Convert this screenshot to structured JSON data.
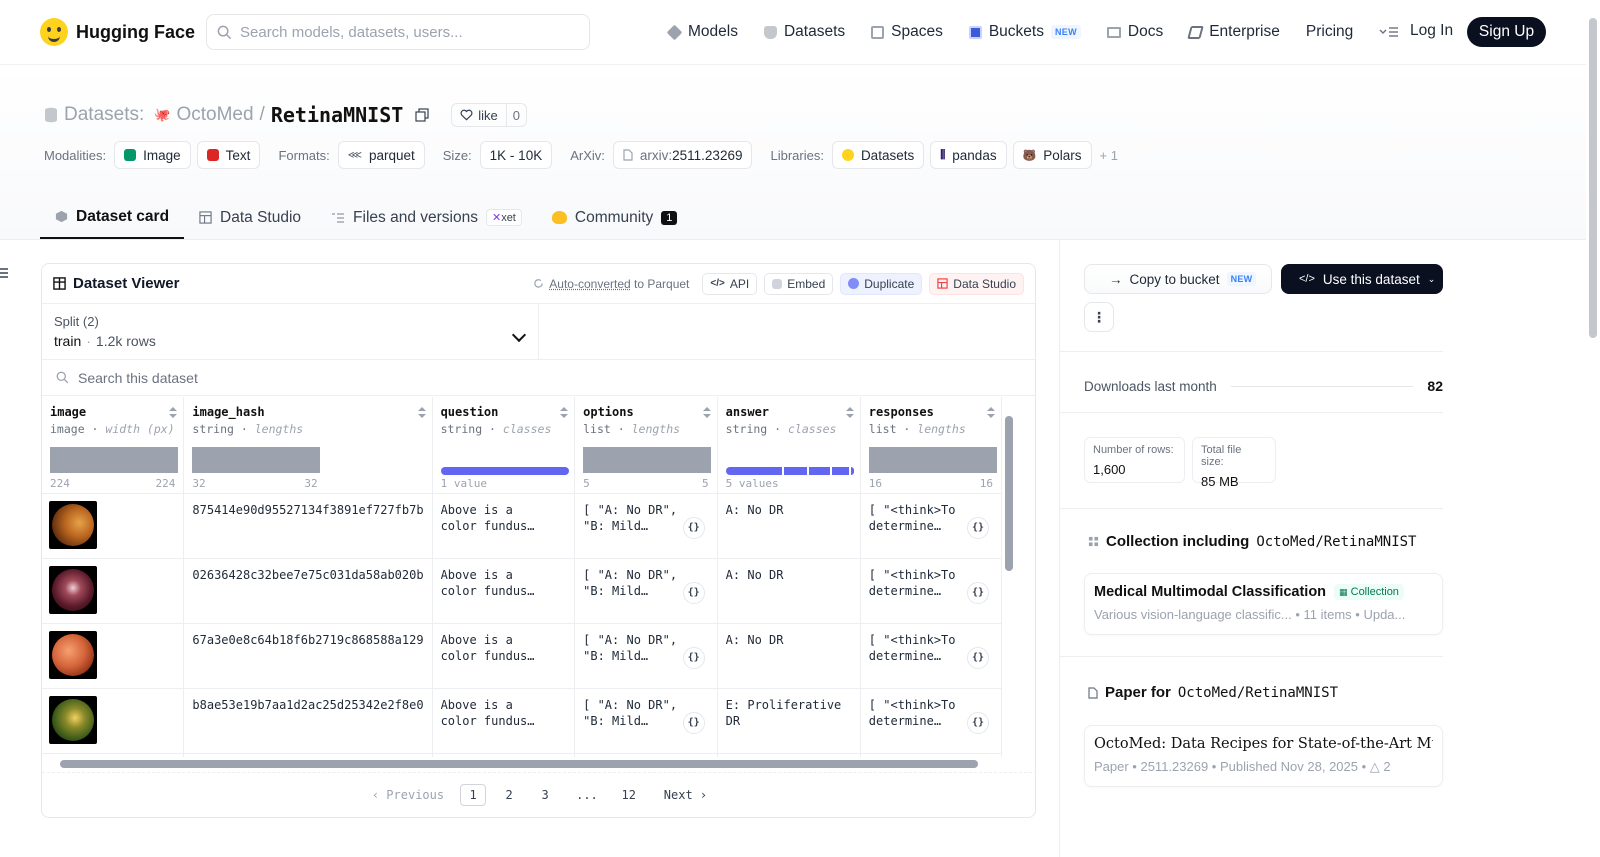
{
  "nav": {
    "brand": "Hugging Face",
    "search_placeholder": "Search models, datasets, users...",
    "links": [
      {
        "label": "Models",
        "icon": "models-icon"
      },
      {
        "label": "Datasets",
        "icon": "datasets-icon"
      },
      {
        "label": "Spaces",
        "icon": "spaces-icon"
      },
      {
        "label": "Buckets",
        "icon": "buckets-icon",
        "badge": "NEW"
      },
      {
        "label": "Docs",
        "icon": "docs-icon"
      },
      {
        "label": "Enterprise",
        "icon": "enterprise-icon"
      },
      {
        "label": "Pricing"
      }
    ],
    "login": "Log In",
    "signup": "Sign Up"
  },
  "header": {
    "section_label": "Datasets:",
    "org": "OctoMed",
    "separator": "/",
    "name": "RetinaMNIST",
    "like_label": "like",
    "like_count": "0",
    "modalities_label": "Modalities:",
    "modalities": [
      "Image",
      "Text"
    ],
    "formats_label": "Formats:",
    "format": "parquet",
    "size_label": "Size:",
    "size": "1K - 10K",
    "arxiv_label": "ArXiv:",
    "arxiv_prefix": "arxiv:",
    "arxiv_id": "2511.23269",
    "libraries_label": "Libraries:",
    "libraries": [
      "Datasets",
      "pandas",
      "Polars"
    ],
    "libraries_more": "+ 1"
  },
  "tabs": {
    "dataset_card": "Dataset card",
    "data_studio": "Data Studio",
    "files": "Files and versions",
    "xet": "xet",
    "community": "Community",
    "community_count": "1"
  },
  "viewer": {
    "title": "Dataset Viewer",
    "auto_converted": "Auto-converted",
    "to_parquet": " to Parquet",
    "api": "API",
    "embed": "Embed",
    "duplicate": "Duplicate",
    "data_studio": "Data Studio",
    "split_label": "Split (2)",
    "split_value": "train",
    "split_dot": "·",
    "split_rows": "1.2k rows",
    "search_placeholder": "Search this dataset",
    "columns": [
      {
        "name": "image",
        "type": "image",
        "stat": "width (px)",
        "min": "224",
        "max": "224"
      },
      {
        "name": "image_hash",
        "type": "string",
        "stat": "lengths",
        "min": "32",
        "max": "32"
      },
      {
        "name": "question",
        "type": "string",
        "stat": "classes",
        "summary": "1 value"
      },
      {
        "name": "options",
        "type": "list",
        "stat": "lengths",
        "min": "5",
        "max": "5"
      },
      {
        "name": "answer",
        "type": "string",
        "stat": "classes",
        "summary": "5 values"
      },
      {
        "name": "responses",
        "type": "list",
        "stat": "lengths",
        "min": "16",
        "max": "16"
      }
    ],
    "type_sep": " · ",
    "rows": [
      {
        "hash": "875414e90d95527134f3891ef727fb7b",
        "question": "Above is a color fundus image of...",
        "options": "[ \"A: No DR\", \"B: Mild DR\"...",
        "answer": "A: No DR",
        "responses": "[ \"<think>To determine th..."
      },
      {
        "hash": "02636428c32bee7e75c031da58ab020b",
        "question": "Above is a color fundus image of...",
        "options": "[ \"A: No DR\", \"B: Mild DR\"...",
        "answer": "A: No DR",
        "responses": "[ \"<think>To determine th..."
      },
      {
        "hash": "67a3e0e8c64b18f6b2719c868588a129",
        "question": "Above is a color fundus image of...",
        "options": "[ \"A: No DR\", \"B: Mild DR\"...",
        "answer": "A: No DR",
        "responses": "[ \"<think>To determine th..."
      },
      {
        "hash": "b8ae53e19b7aa1d2ac25d25342e2f8e0",
        "question": "Above is a color fundus image of...",
        "options": "[ \"A: No DR\", \"B: Mild DR\"...",
        "answer": "E: Proliferative DR",
        "responses": "[ \"<think>To determine th..."
      }
    ],
    "json_btn": "{}",
    "pager": {
      "prev": "‹ Previous",
      "pages": [
        "1",
        "2",
        "3",
        "...",
        "12"
      ],
      "next": "Next ›"
    }
  },
  "sidebar": {
    "copy_bucket": "Copy to bucket",
    "copy_badge": "NEW",
    "use_dataset": "Use this dataset",
    "more": "⋮",
    "downloads_label": "Downloads last month",
    "downloads_value": "82",
    "rows_label": "Number of rows:",
    "rows_value": "1,600",
    "filesize_label": "Total file size:",
    "filesize_value": "85 MB",
    "collection_heading": "Collection including",
    "collection_repo": "OctoMed/RetinaMNIST",
    "collection_title": "Medical Multimodal Classification",
    "collection_badge": "Collection",
    "collection_sub": "Various vision-language classific... • 11 items • Upda...",
    "paper_heading": "Paper for",
    "paper_repo": "OctoMed/RetinaMNIST",
    "paper_title": "OctoMed: Data Recipes for State-of-the-Art Multi...",
    "paper_sub": "Paper • 2511.23269 • Published Nov 28, 2025 • △ 2"
  }
}
